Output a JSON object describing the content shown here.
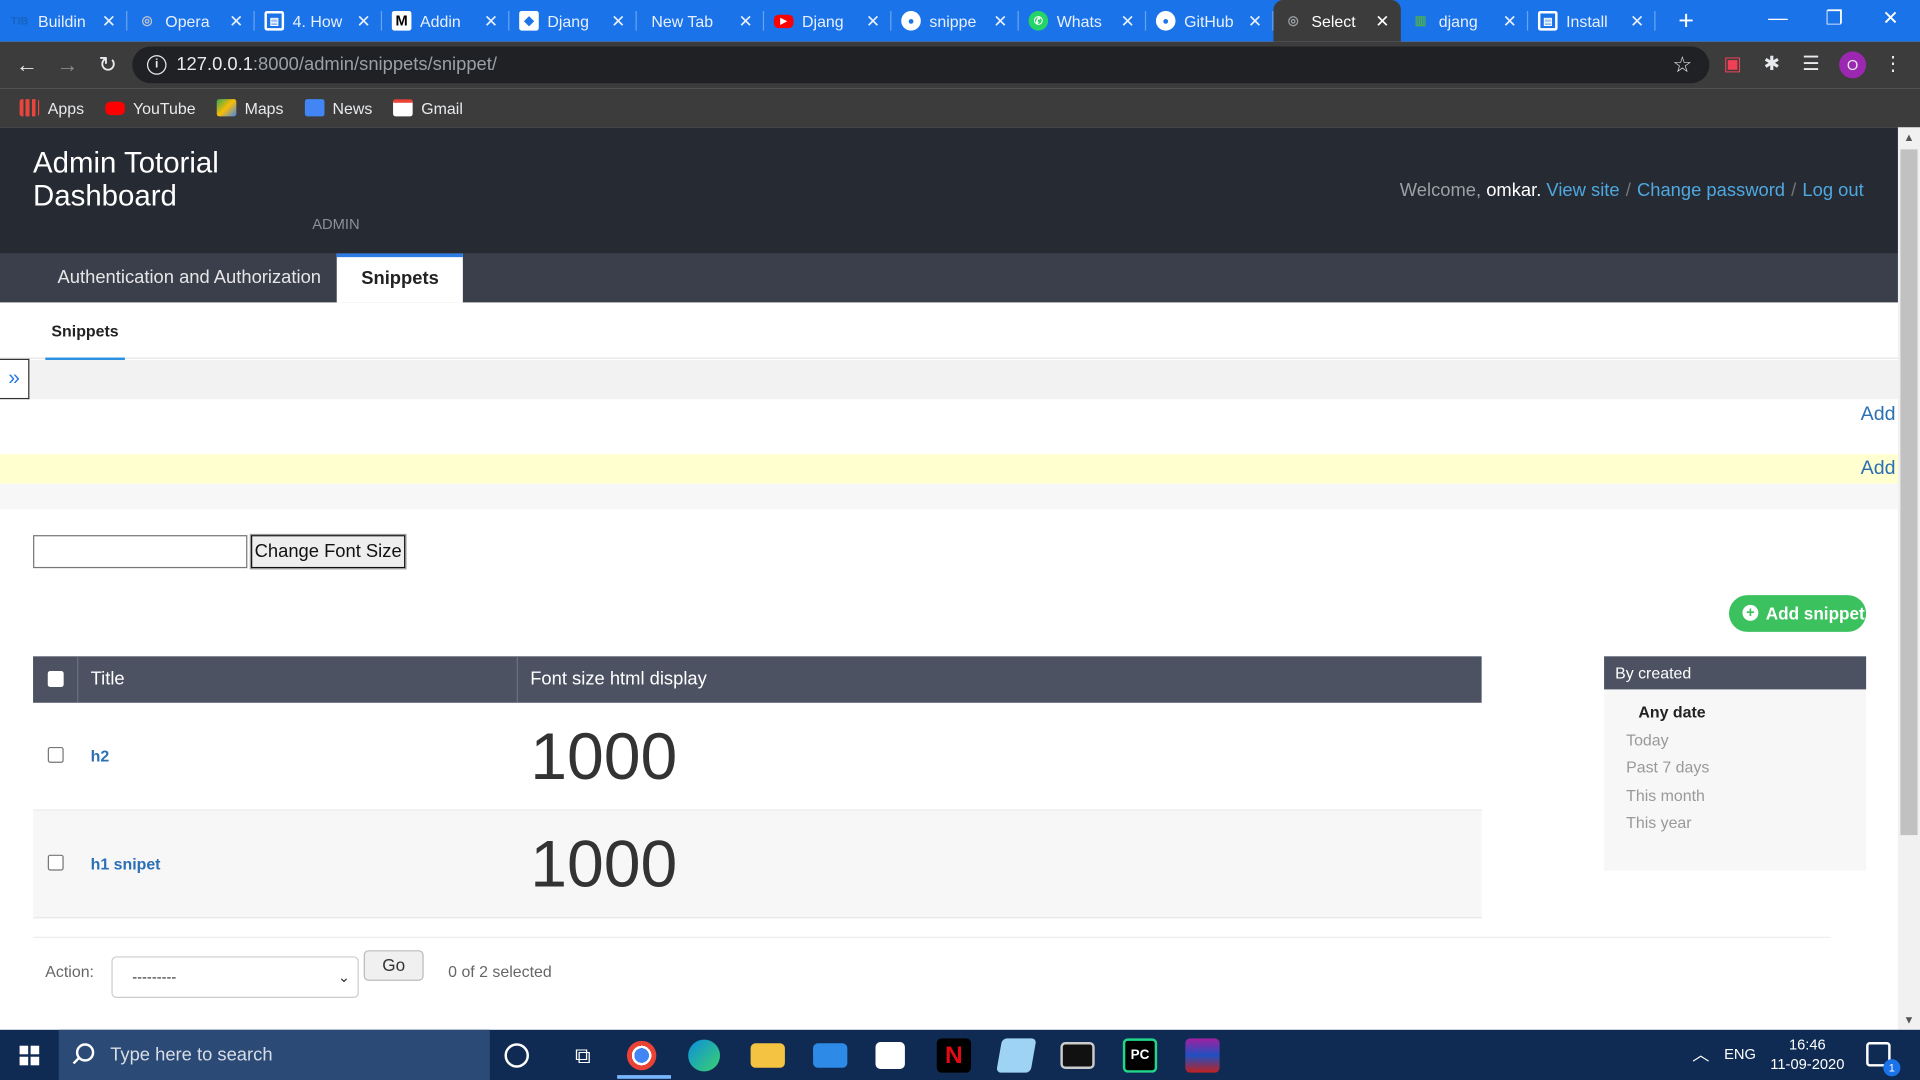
{
  "browser": {
    "tabs": [
      {
        "title": "Buildin",
        "icon": "TIB",
        "icon_color": "#1565c0"
      },
      {
        "title": "Opera",
        "icon": "globe-icon",
        "icon_color": "#9aa0a6"
      },
      {
        "title": "4. How",
        "icon": "book-icon",
        "icon_color": "#ffffff"
      },
      {
        "title": "Addin",
        "icon": "M",
        "icon_color": "#000000"
      },
      {
        "title": "Djang",
        "icon": "ribbon-icon",
        "icon_color": "#ffffff"
      },
      {
        "title": "New Tab",
        "icon": "",
        "icon_color": ""
      },
      {
        "title": "Djang",
        "icon": "youtube-icon",
        "icon_color": "#ff0000"
      },
      {
        "title": "snippe",
        "icon": "github-icon",
        "icon_color": "#ffffff"
      },
      {
        "title": "Whats",
        "icon": "whatsapp-icon",
        "icon_color": "#25d366"
      },
      {
        "title": "GitHub",
        "icon": "github-icon",
        "icon_color": "#ffffff"
      },
      {
        "title": "Select",
        "icon": "globe-icon",
        "icon_color": "#9aa0a6",
        "active": true
      },
      {
        "title": "djang",
        "icon": "bars-icon",
        "icon_color": "#4caf50"
      },
      {
        "title": "Install",
        "icon": "book-icon",
        "icon_color": "#ffffff"
      }
    ],
    "new_tab": "+",
    "url_host": "127.0.0.1",
    "url_path": ":8000/admin/snippets/snippet/",
    "profile_initial": "O",
    "bookmarks": [
      {
        "label": "Apps",
        "color": "#e8453c"
      },
      {
        "label": "YouTube",
        "color": "#ff0000"
      },
      {
        "label": "Maps",
        "color": "#34a853"
      },
      {
        "label": "News",
        "color": "#4285f4"
      },
      {
        "label": "Gmail",
        "color": "#ea4335"
      }
    ]
  },
  "admin": {
    "brand": "Admin Totorial Dashboard",
    "brand_sub": "ADMIN",
    "welcome": "Welcome,",
    "username": "omkar.",
    "view_site": "View site",
    "change_password": "Change password",
    "log_out": "Log out",
    "app_tabs": [
      {
        "label": "Authentication and Authorization"
      },
      {
        "label": "Snippets",
        "active": true
      }
    ],
    "subnav": "Snippets",
    "toggle": "»",
    "add_top": "Add",
    "add_yellow": "Add",
    "change_font_size": "Change Font Size",
    "add_snippet": "Add snippet",
    "columns": [
      "Title",
      "Font size html display"
    ],
    "rows": [
      {
        "title": "h2",
        "font_size": "1000"
      },
      {
        "title": "h1 snipet",
        "font_size": "1000"
      }
    ],
    "filter": {
      "heading": "By created",
      "options": [
        "Any date",
        "Today",
        "Past 7 days",
        "This month",
        "This year"
      ],
      "selected": "Any date"
    },
    "action_label": "Action:",
    "action_select": "---------",
    "go": "Go",
    "counter": "0 of 2 selected"
  },
  "taskbar": {
    "search_placeholder": "Type here to search",
    "language": "ENG",
    "time": "16:46",
    "date": "11-09-2020",
    "notifications": "1"
  }
}
